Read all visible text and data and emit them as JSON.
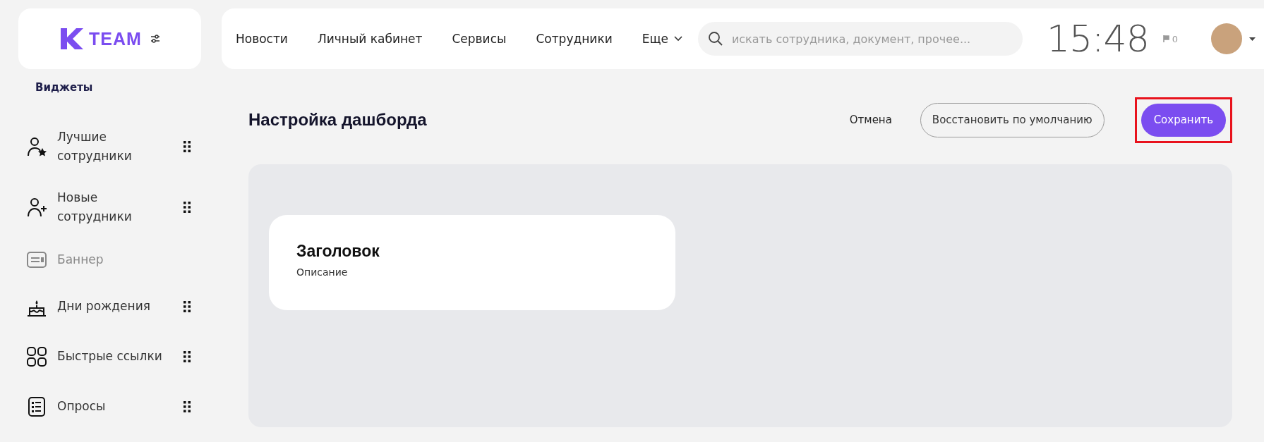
{
  "header": {
    "logo": "TEAM",
    "nav": [
      {
        "label": "Новости",
        "dropdown": false
      },
      {
        "label": "Личный кабинет",
        "dropdown": false
      },
      {
        "label": "Сервисы",
        "dropdown": false
      },
      {
        "label": "Сотрудники",
        "dropdown": false
      },
      {
        "label": "Еще",
        "dropdown": true
      }
    ],
    "search": {
      "placeholder": "искать сотрудника, документ, прочее..."
    },
    "clock": "15:48",
    "flags": "0"
  },
  "sidebar": {
    "title": "Виджеты",
    "items": [
      {
        "label": "Лучшие сотрудники",
        "disabled": false
      },
      {
        "label": "Новые сотрудники",
        "disabled": false
      },
      {
        "label": "Баннер",
        "disabled": true
      },
      {
        "label": "Дни рождения",
        "disabled": false
      },
      {
        "label": "Быстрые ссылки",
        "disabled": false
      },
      {
        "label": "Опросы",
        "disabled": false
      }
    ]
  },
  "main": {
    "title": "Настройка дашборда",
    "actions": [
      {
        "label": "Отмена",
        "kind": "link",
        "highlighted": false
      },
      {
        "label": "Восстановить по умолчанию",
        "kind": "outline",
        "highlighted": false
      },
      {
        "label": "Сохранить",
        "kind": "primary",
        "highlighted": true
      }
    ],
    "widgets": [
      {
        "title": "Заголовок",
        "description": "Описание"
      }
    ]
  }
}
